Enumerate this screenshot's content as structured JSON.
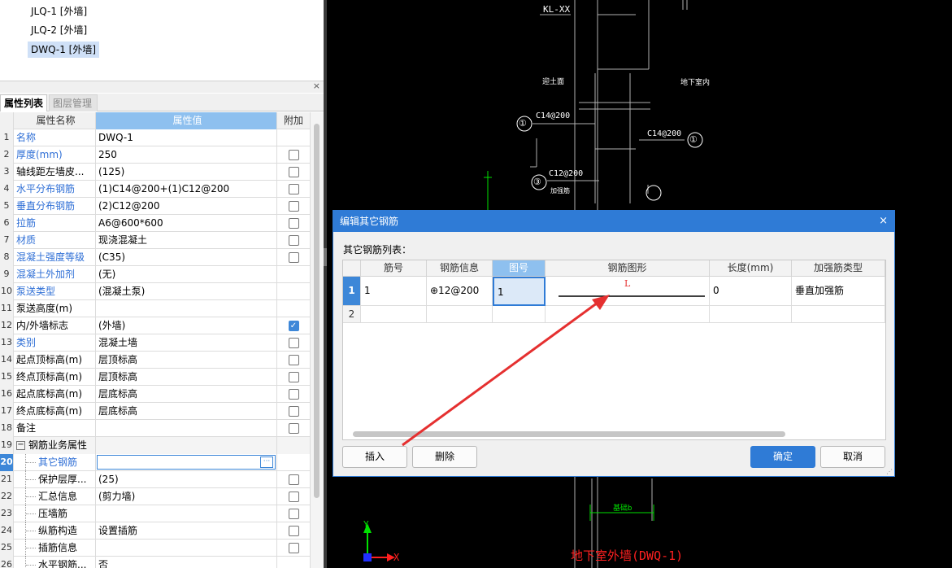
{
  "tree": {
    "items": [
      {
        "label": "JLQ-1 [外墙]"
      },
      {
        "label": "JLQ-2 [外墙]"
      },
      {
        "label": "DWQ-1 [外墙]"
      }
    ]
  },
  "panel": {
    "close": "×",
    "tabs": [
      {
        "label": "属性列表"
      },
      {
        "label": "图层管理"
      }
    ]
  },
  "props": {
    "headers": {
      "name": "属性名称",
      "value": "属性值",
      "extra": "附加"
    },
    "rows": [
      {
        "num": "1",
        "name": "名称",
        "value": "DWQ-1"
      },
      {
        "num": "2",
        "name": "厚度(mm)",
        "value": "250"
      },
      {
        "num": "3",
        "name": "轴线距左墙皮...",
        "value": "(125)"
      },
      {
        "num": "4",
        "name": "水平分布钢筋",
        "value": "(1)C14@200+(1)C12@200"
      },
      {
        "num": "5",
        "name": "垂直分布钢筋",
        "value": "(2)C12@200"
      },
      {
        "num": "6",
        "name": "拉筋",
        "value": "A6@600*600"
      },
      {
        "num": "7",
        "name": "材质",
        "value": "现浇混凝土"
      },
      {
        "num": "8",
        "name": "混凝土强度等级",
        "value": "(C35)"
      },
      {
        "num": "9",
        "name": "混凝土外加剂",
        "value": "(无)"
      },
      {
        "num": "10",
        "name": "泵送类型",
        "value": "(混凝土泵)"
      },
      {
        "num": "11",
        "name": "泵送高度(m)",
        "value": ""
      },
      {
        "num": "12",
        "name": "内/外墙标志",
        "value": "(外墙)"
      },
      {
        "num": "13",
        "name": "类别",
        "value": "混凝土墙"
      },
      {
        "num": "14",
        "name": "起点顶标高(m)",
        "value": "层顶标高"
      },
      {
        "num": "15",
        "name": "终点顶标高(m)",
        "value": "层顶标高"
      },
      {
        "num": "16",
        "name": "起点底标高(m)",
        "value": "层底标高"
      },
      {
        "num": "17",
        "name": "终点底标高(m)",
        "value": "层底标高"
      },
      {
        "num": "18",
        "name": "备注",
        "value": ""
      },
      {
        "num": "19",
        "name": "钢筋业务属性",
        "value": "",
        "expander": "−"
      },
      {
        "num": "20",
        "name": "其它钢筋",
        "value": "",
        "edit_button": "···"
      },
      {
        "num": "21",
        "name": "保护层厚...",
        "value": "(25)"
      },
      {
        "num": "22",
        "name": "汇总信息",
        "value": "(剪力墙)"
      },
      {
        "num": "23",
        "name": "压墙筋",
        "value": ""
      },
      {
        "num": "24",
        "name": "纵筋构造",
        "value": "设置插筋"
      },
      {
        "num": "25",
        "name": "插筋信息",
        "value": ""
      },
      {
        "num": "26",
        "name": "水平钢筋...",
        "value": "否"
      }
    ],
    "checks": {
      "12": true
    }
  },
  "cad": {
    "labels": [
      "KL-XX",
      "迎土面",
      "地下室内",
      "C14@200",
      "C14@200",
      "C12@200",
      "加强筋",
      "①",
      "①",
      "③",
      "基础b",
      "地下室外墙(DWQ-1)",
      "Y",
      "X"
    ],
    "colors": {
      "white": "#ffffff",
      "green": "#00e000",
      "red": "#ff2020",
      "grey": "#b0b0b0"
    }
  },
  "dialog": {
    "title": "编辑其它钢筋",
    "close": "×",
    "list_label": "其它钢筋列表：",
    "headers": [
      "筋号",
      "钢筋信息",
      "图号",
      "钢筋图形",
      "长度(mm)",
      "加强筋类型"
    ],
    "rows": [
      {
        "rownum": "1",
        "bar_no": "1",
        "info": "⊕12@200",
        "fig_no": "1",
        "shape_label": "L",
        "length": "0",
        "type": "垂直加强筋"
      },
      {
        "rownum": "2",
        "bar_no": "",
        "info": "",
        "fig_no": "",
        "shape_label": "",
        "length": "",
        "type": ""
      }
    ],
    "buttons": {
      "insert": "插入",
      "delete": "删除",
      "ok": "确定",
      "cancel": "取消"
    },
    "accent": "#2f7bd6",
    "annotation_arrow_color": "#e53030"
  }
}
